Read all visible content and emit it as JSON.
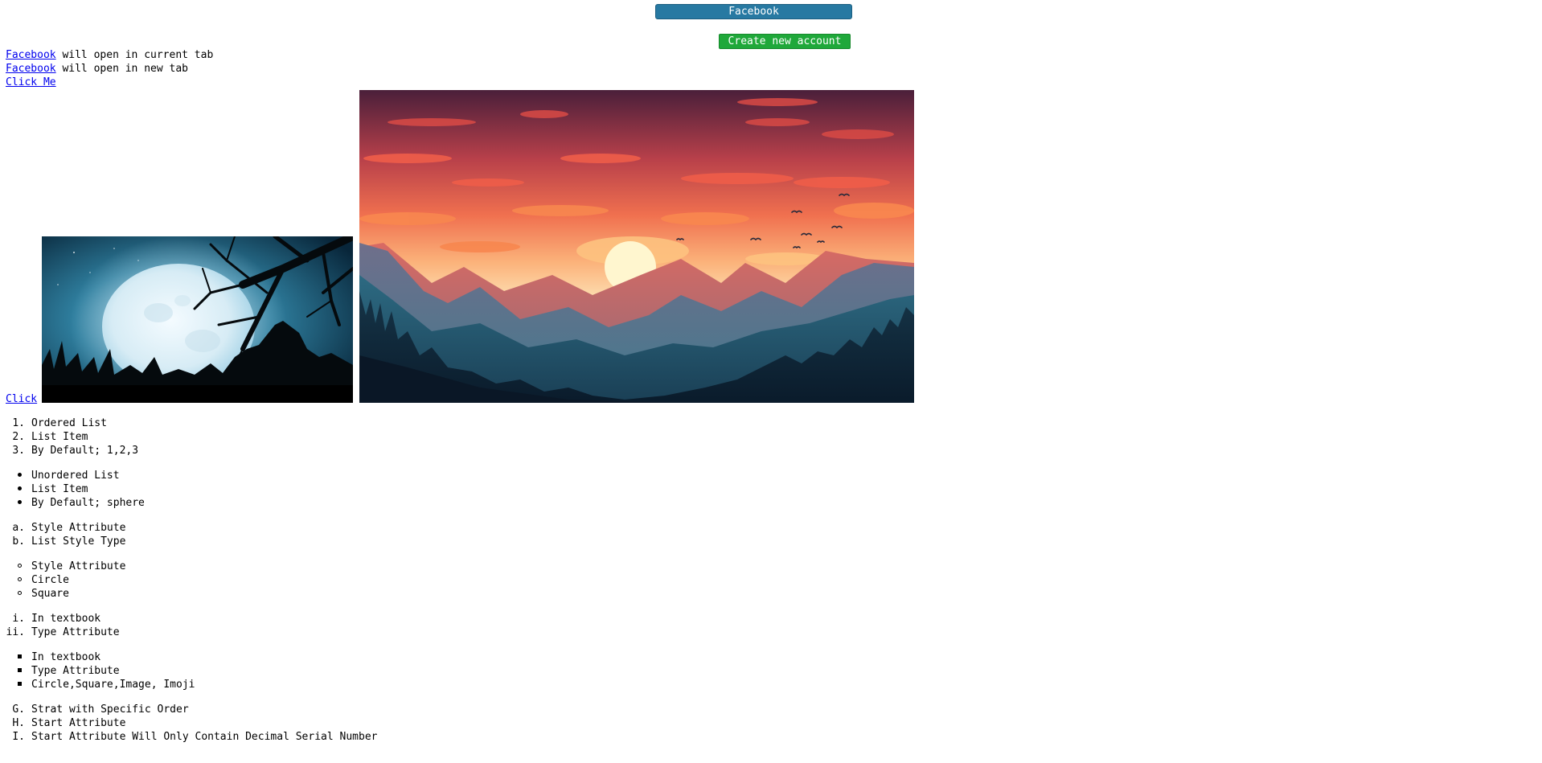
{
  "buttons": {
    "facebook": "Facebook",
    "create_account": "Create new account"
  },
  "links": {
    "line1": {
      "link": "Facebook",
      "text": " will open in current tab"
    },
    "line2": {
      "link": "Facebook",
      "text": " will open in new tab"
    },
    "click_me": "Click Me",
    "click": "Click"
  },
  "images": {
    "small": "night-moon-tree-image",
    "large": "sunset-mountains-image"
  },
  "lists": {
    "ordered": {
      "markers": [
        "1.",
        "2.",
        "3."
      ],
      "items": [
        "Ordered List",
        "List Item",
        "By Default; 1,2,3"
      ]
    },
    "unordered": {
      "items": [
        "Unordered List",
        "List Item",
        "By Default; sphere"
      ]
    },
    "alpha": {
      "markers": [
        "a.",
        "b."
      ],
      "items": [
        "Style Attribute",
        "List Style Type"
      ]
    },
    "circle": {
      "items": [
        "Style Attribute",
        "Circle",
        "Square"
      ]
    },
    "roman": {
      "markers": [
        "i.",
        "ii."
      ],
      "items": [
        "In textbook",
        "Type Attribute"
      ]
    },
    "square": {
      "items": [
        "In textbook",
        "Type Attribute",
        "Circle,Square,Image, Imoji"
      ]
    },
    "start": {
      "markers": [
        "G.",
        "H.",
        "I."
      ],
      "items": [
        "Strat with Specific Order",
        "Start Attribute",
        "Start Attribute Will Only Contain Decimal Serial Number"
      ]
    }
  }
}
